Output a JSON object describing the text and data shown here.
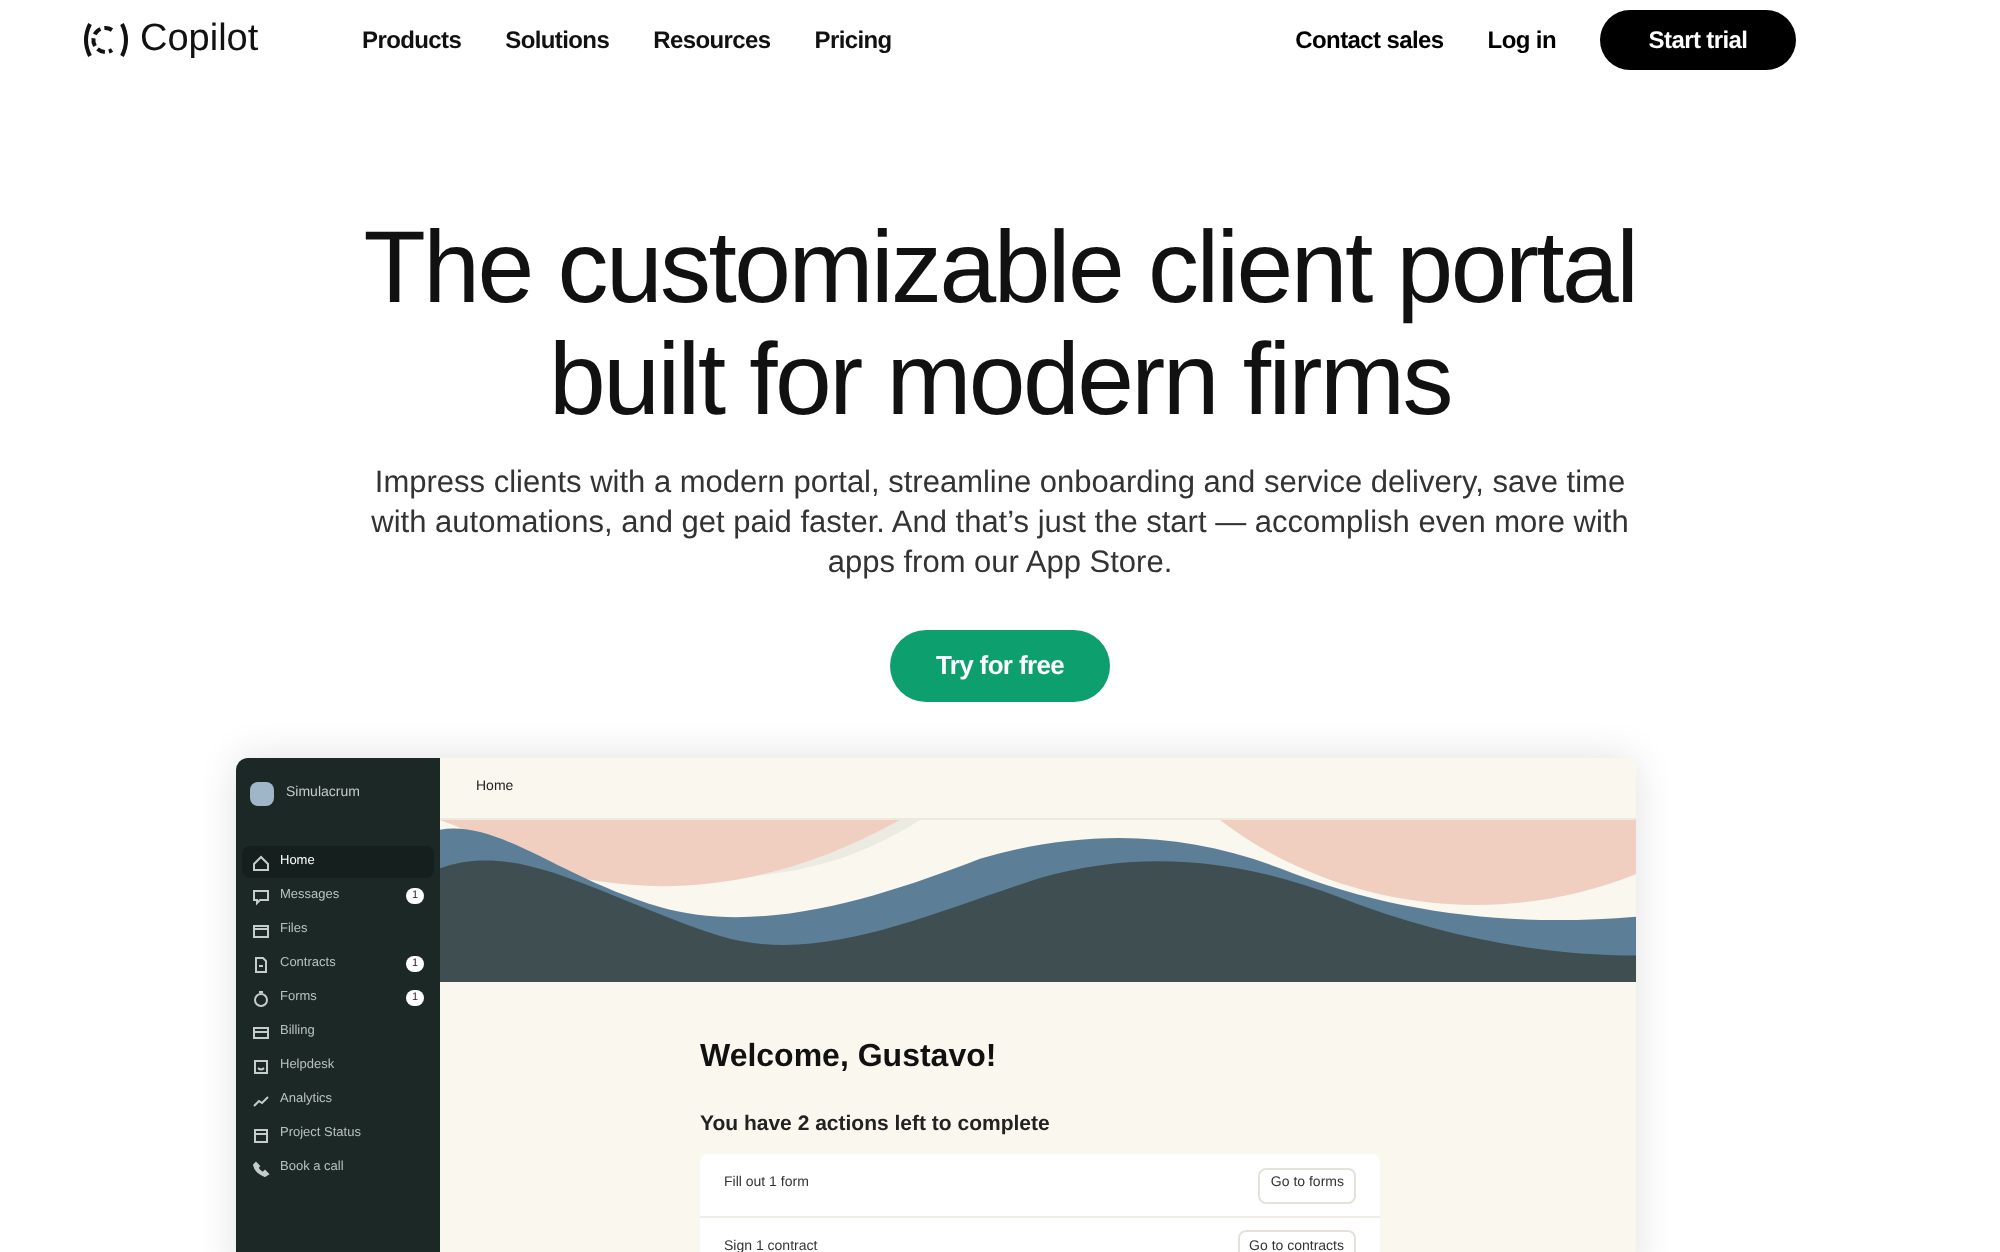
{
  "header": {
    "logo": "Copilot",
    "nav": [
      "Products",
      "Solutions",
      "Resources",
      "Pricing"
    ],
    "contact": "Contact sales",
    "login": "Log in",
    "cta": "Start trial"
  },
  "hero": {
    "title": "The customizable client portal built for modern firms",
    "subtitle": "Impress clients with a modern portal, streamline onboarding and service delivery, save time with automations, and get paid faster. And that’s just the start — accomplish even more with apps from our App Store.",
    "cta": "Try for free"
  },
  "preview": {
    "workspace": "Simulacrum",
    "sidebar": [
      {
        "kind": "home",
        "label": "Home",
        "selected": true
      },
      {
        "kind": "messages",
        "label": "Messages",
        "selected": false,
        "badge": "1"
      },
      {
        "kind": "files",
        "label": "Files",
        "selected": false
      },
      {
        "kind": "contracts",
        "label": "Contracts",
        "selected": false,
        "badge": "1"
      },
      {
        "kind": "forms",
        "label": "Forms",
        "selected": false,
        "badge": "1"
      },
      {
        "kind": "billing",
        "label": "Billing",
        "selected": false
      },
      {
        "kind": "helpdesk",
        "label": "Helpdesk",
        "selected": false
      },
      {
        "kind": "analytics",
        "label": "Analytics",
        "selected": false
      },
      {
        "kind": "status",
        "label": "Project Status",
        "selected": false
      },
      {
        "kind": "call",
        "label": "Book a call",
        "selected": false
      }
    ],
    "breadcrumb": "Home",
    "welcome": "Welcome, Gustavo!",
    "actions_title": "You have 2 actions left to complete",
    "actions": [
      {
        "label": "Fill out 1 form",
        "button": "Go to forms"
      },
      {
        "label": "Sign 1 contract",
        "button": "Go to contracts"
      }
    ]
  }
}
